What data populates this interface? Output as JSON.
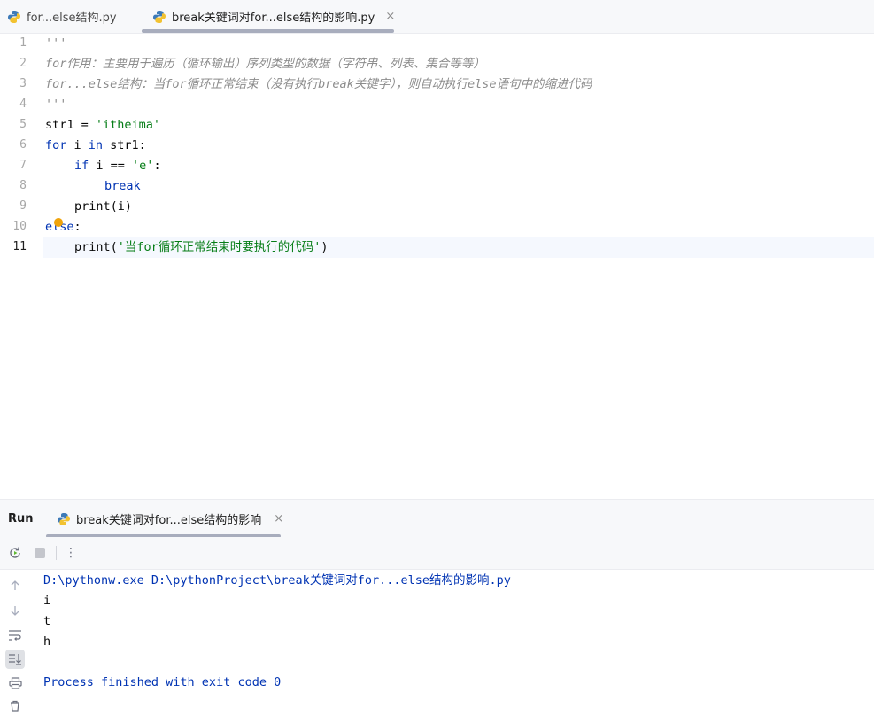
{
  "tabs": [
    {
      "label": "for...else结构.py"
    },
    {
      "label": "break关键词对for...else结构的影响.py",
      "close": "×"
    }
  ],
  "editor": {
    "line_numbers": [
      "1",
      "2",
      "3",
      "4",
      "5",
      "6",
      "7",
      "8",
      "9",
      "10",
      "11"
    ],
    "lines": {
      "l1": "'''",
      "l2": "for作用：主要用于遍历（循环输出）序列类型的数据（字符串、列表、集合等等）",
      "l3": "for...else结构：当for循环正常结束（没有执行break关键字），则自动执行else语句中的缩进代码",
      "l4": "'''",
      "l5_a": "str1 = ",
      "l5_b": "'itheima'",
      "l6_kw1": "for",
      "l6_a": " i ",
      "l6_kw2": "in",
      "l6_b": " str1:",
      "l7_kw": "if",
      "l7_a": " i == ",
      "l7_str": "'e'",
      "l7_b": ":",
      "l8_kw": "break",
      "l9": "print(i)",
      "l10_kw": "else",
      "l10_b": ":",
      "l11_a": "print(",
      "l11_str": "'当for循环正常结束时要执行的代码'",
      "l11_b": ")"
    }
  },
  "run": {
    "label": "Run",
    "tab_label": "break关键词对for...else结构的影响",
    "close": "×",
    "more": "⋮"
  },
  "console": {
    "command": "D:\\pythonw.exe D:\\pythonProject\\break关键词对for...else结构的影响.py",
    "outputs": [
      "i",
      "t",
      "h"
    ],
    "finish": "Process finished with exit code 0"
  },
  "colors": {
    "keyword": "#0033b3",
    "string": "#067d17",
    "comment": "#8c8c8c",
    "accent": "#3574f0"
  }
}
